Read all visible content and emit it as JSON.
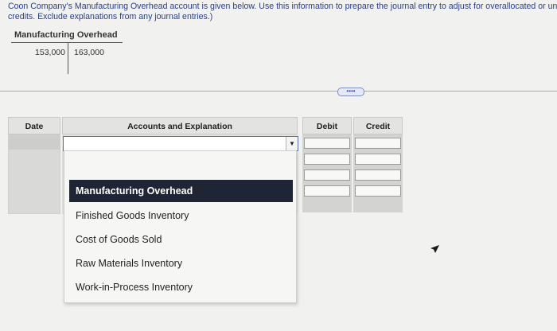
{
  "instructions": {
    "line1": "Coon Company's Manufacturing Overhead account is given below. Use this information to prepare the journal entry to adjust for overallocated or undera",
    "line2": "credits. Exclude explanations from any journal entries.)"
  },
  "t_account": {
    "title": "Manufacturing Overhead",
    "debit": "153,000",
    "credit": "163,000"
  },
  "more_button": "••••",
  "journal": {
    "headers": {
      "date": "Date",
      "accounts": "Accounts and Explanation",
      "debit": "Debit",
      "credit": "Credit"
    },
    "account_select_value": ""
  },
  "dropdown": {
    "options": [
      {
        "label": "Manufacturing Overhead",
        "selected": true
      },
      {
        "label": "Finished Goods Inventory",
        "selected": false
      },
      {
        "label": "Cost of Goods Sold",
        "selected": false
      },
      {
        "label": "Raw Materials Inventory",
        "selected": false
      },
      {
        "label": "Work-in-Process Inventory",
        "selected": false
      }
    ]
  },
  "colors": {
    "instruction_text": "#2a3f88",
    "selected_option_bg": "#1f2535"
  },
  "icons": {
    "select_arrow": "triangle-down-icon",
    "cursor": "mouse-pointer-icon"
  }
}
